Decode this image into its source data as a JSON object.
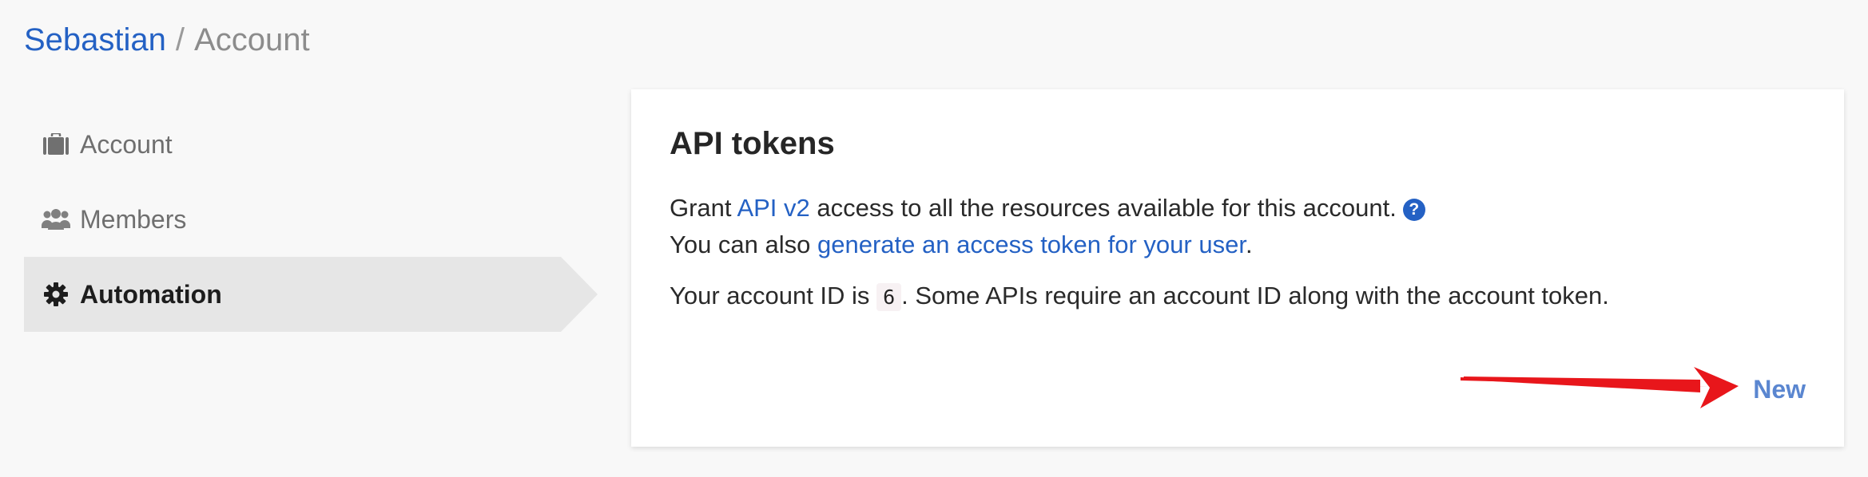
{
  "breadcrumb": {
    "owner": "Sebastian",
    "separator": "/",
    "current": "Account"
  },
  "sidebar": {
    "items": [
      {
        "label": "Account",
        "icon": "briefcase-icon",
        "active": false
      },
      {
        "label": "Members",
        "icon": "users-icon",
        "active": false
      },
      {
        "label": "Automation",
        "icon": "gear-icon",
        "active": true
      }
    ]
  },
  "card": {
    "title": "API tokens",
    "line1_prefix": "Grant ",
    "line1_link": "API v2",
    "line1_suffix": " access to all the resources available for this account.",
    "help_icon": "?",
    "line2_prefix": "You can also ",
    "line2_link": "generate an access token for your user",
    "line2_suffix": ".",
    "line3_prefix": "Your account ID is ",
    "account_id": "6",
    "line3_suffix": ". Some APIs require an account ID along with the account token.",
    "new_label": "New"
  },
  "colors": {
    "link": "#2461c4",
    "new_button": "#5a86d0",
    "arrow": "#e8161b",
    "active_nav_bg": "#e6e6e6"
  }
}
